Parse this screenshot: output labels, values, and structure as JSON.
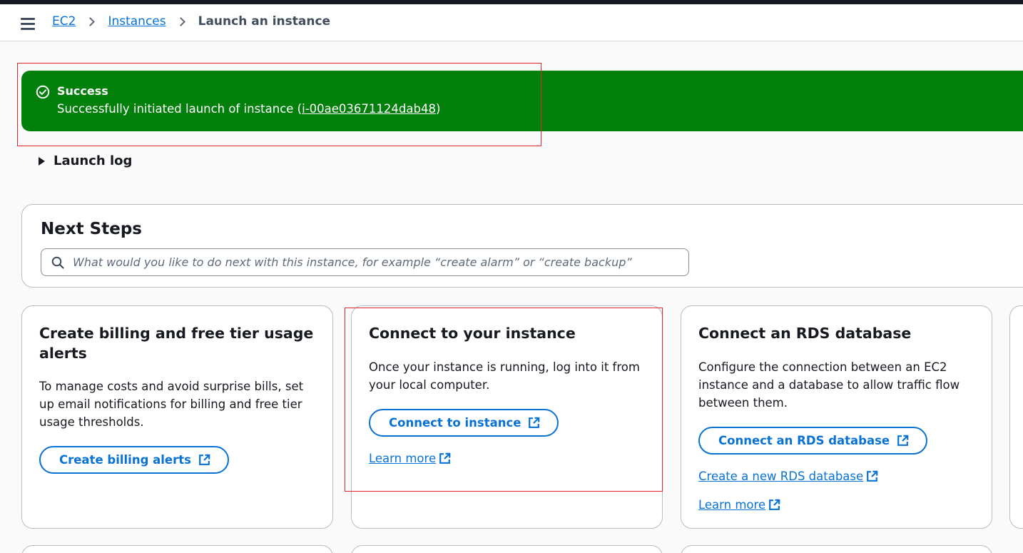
{
  "breadcrumb": {
    "items": [
      {
        "label": "EC2"
      },
      {
        "label": "Instances"
      }
    ],
    "current": "Launch an instance"
  },
  "flash": {
    "type": "success",
    "title": "Success",
    "message_prefix": "Successfully initiated launch of instance (",
    "instance_id": "i-00ae03671124dab48",
    "message_suffix": ")"
  },
  "launch_log": {
    "label": "Launch log",
    "expanded": false
  },
  "next_steps": {
    "title": "Next Steps",
    "search_placeholder": "What would you like to do next with this instance, for example “create alarm” or “create backup”"
  },
  "cards": [
    {
      "title": "Create billing and free tier usage alerts",
      "description": "To manage costs and avoid surprise bills, set up email notifications for billing and free tier usage thresholds.",
      "button": "Create billing alerts"
    },
    {
      "title": "Connect to your instance",
      "description": "Once your instance is running, log into it from your local computer.",
      "button": "Connect to instance",
      "link": "Learn more"
    },
    {
      "title": "Connect an RDS database",
      "description": "Configure the connection between an EC2 instance and a database to allow traffic flow between them.",
      "button": "Connect an RDS database",
      "link": "Create a new RDS database",
      "link2": "Learn more"
    }
  ],
  "colors": {
    "accent": "#0972d3",
    "success": "#037f0c",
    "highlight": "#e0262d"
  },
  "icons": [
    "menu-icon",
    "chevron-right-icon",
    "check-circle-icon",
    "caret-right-icon",
    "search-icon",
    "external-link-icon"
  ]
}
